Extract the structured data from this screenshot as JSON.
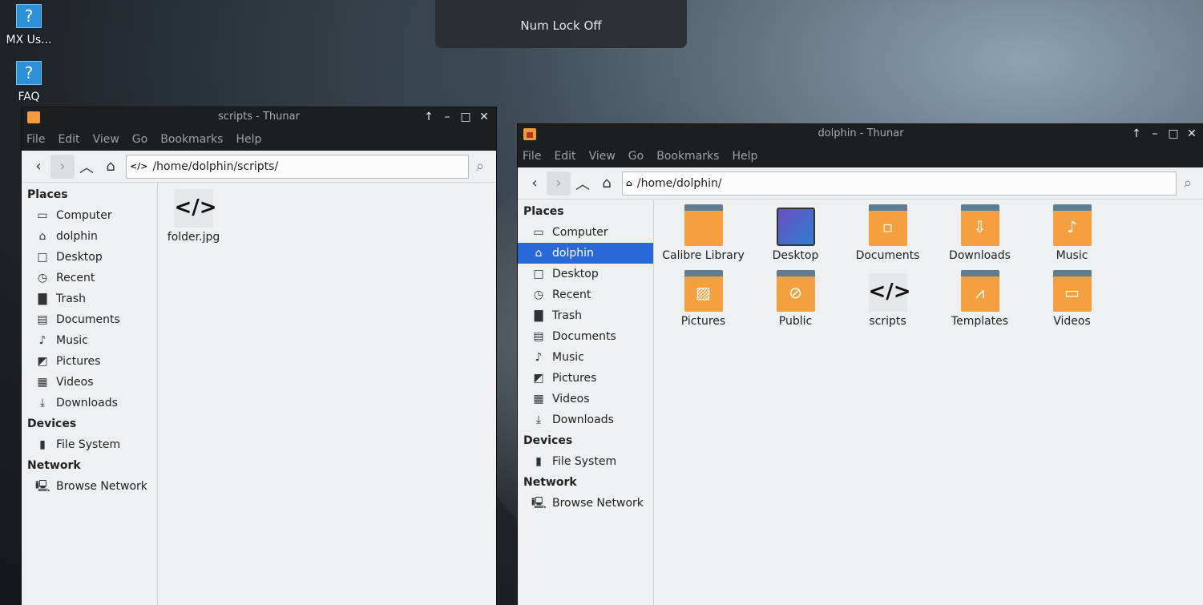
{
  "desktop": {
    "icons": [
      {
        "label": "MX Us...",
        "icon": "help-icon"
      },
      {
        "label": "FAQ",
        "icon": "help-icon"
      }
    ]
  },
  "osd": {
    "text": "Num Lock Off"
  },
  "window1": {
    "title": "scripts - Thunar",
    "menu": [
      "File",
      "Edit",
      "View",
      "Go",
      "Bookmarks",
      "Help"
    ],
    "path": "/home/dolphin/scripts/",
    "path_icon": "</>",
    "sidebar": {
      "places_header": "Places",
      "places": [
        "Computer",
        "dolphin",
        "Desktop",
        "Recent",
        "Trash",
        "Documents",
        "Music",
        "Pictures",
        "Videos",
        "Downloads"
      ],
      "devices_header": "Devices",
      "devices": [
        "File System"
      ],
      "network_header": "Network",
      "network": [
        "Browse Network"
      ]
    },
    "files": [
      {
        "name": "folder.jpg",
        "icon": "</>"
      }
    ]
  },
  "window2": {
    "title": "dolphin - Thunar",
    "menu": [
      "File",
      "Edit",
      "View",
      "Go",
      "Bookmarks",
      "Help"
    ],
    "path": "/home/dolphin/",
    "sidebar": {
      "places_header": "Places",
      "places": [
        "Computer",
        "dolphin",
        "Desktop",
        "Recent",
        "Trash",
        "Documents",
        "Music",
        "Pictures",
        "Videos",
        "Downloads"
      ],
      "selected": "dolphin",
      "devices_header": "Devices",
      "devices": [
        "File System"
      ],
      "network_header": "Network",
      "network": [
        "Browse Network"
      ]
    },
    "files": [
      "Calibre Library",
      "Desktop",
      "Documents",
      "Downloads",
      "Music",
      "Pictures",
      "Public",
      "scripts",
      "Templates",
      "Videos"
    ],
    "scripts_icon": "</>"
  }
}
